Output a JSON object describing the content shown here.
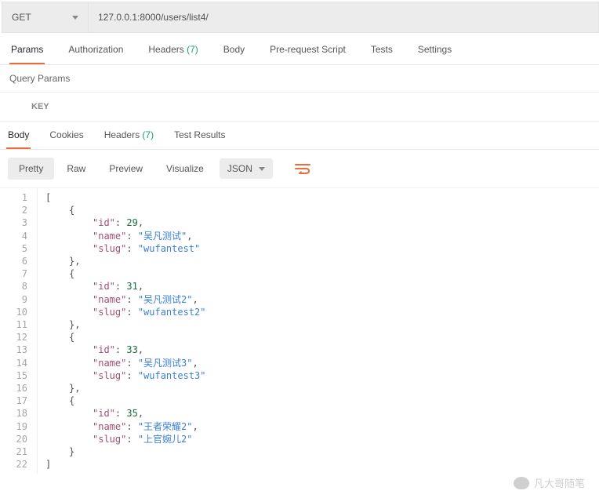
{
  "request": {
    "method": "GET",
    "url": "127.0.0.1:8000/users/list4/"
  },
  "reqTabs": {
    "items": [
      "Params",
      "Authorization",
      "Headers",
      "Body",
      "Pre-request Script",
      "Tests",
      "Settings"
    ],
    "headerCount": "(7)",
    "active": 0,
    "queryParamsLabel": "Query Params",
    "keyHeader": "KEY"
  },
  "resTabs": {
    "items": [
      "Body",
      "Cookies",
      "Headers",
      "Test Results"
    ],
    "headerCount": "(7)",
    "active": 0
  },
  "toolbar": {
    "pretty": "Pretty",
    "raw": "Raw",
    "preview": "Preview",
    "visualize": "Visualize",
    "format": "JSON"
  },
  "body": {
    "data": [
      {
        "id": 29,
        "name": "吴凡测试",
        "slug": "wufantest"
      },
      {
        "id": 31,
        "name": "吴凡测试2",
        "slug": "wufantest2"
      },
      {
        "id": 33,
        "name": "吴凡测试3",
        "slug": "wufantest3"
      },
      {
        "id": 35,
        "name": "王者荣耀2",
        "slug": "上官婉儿2"
      }
    ],
    "lineCount": 22
  },
  "watermark": "凡大哥随笔",
  "chart_data": {
    "type": "table",
    "columns": [
      "id",
      "name",
      "slug"
    ],
    "rows": [
      [
        29,
        "吴凡测试",
        "wufantest"
      ],
      [
        31,
        "吴凡测试2",
        "wufantest2"
      ],
      [
        33,
        "吴凡测试3",
        "wufantest3"
      ],
      [
        35,
        "王者荣耀2",
        "上官婉儿2"
      ]
    ]
  }
}
